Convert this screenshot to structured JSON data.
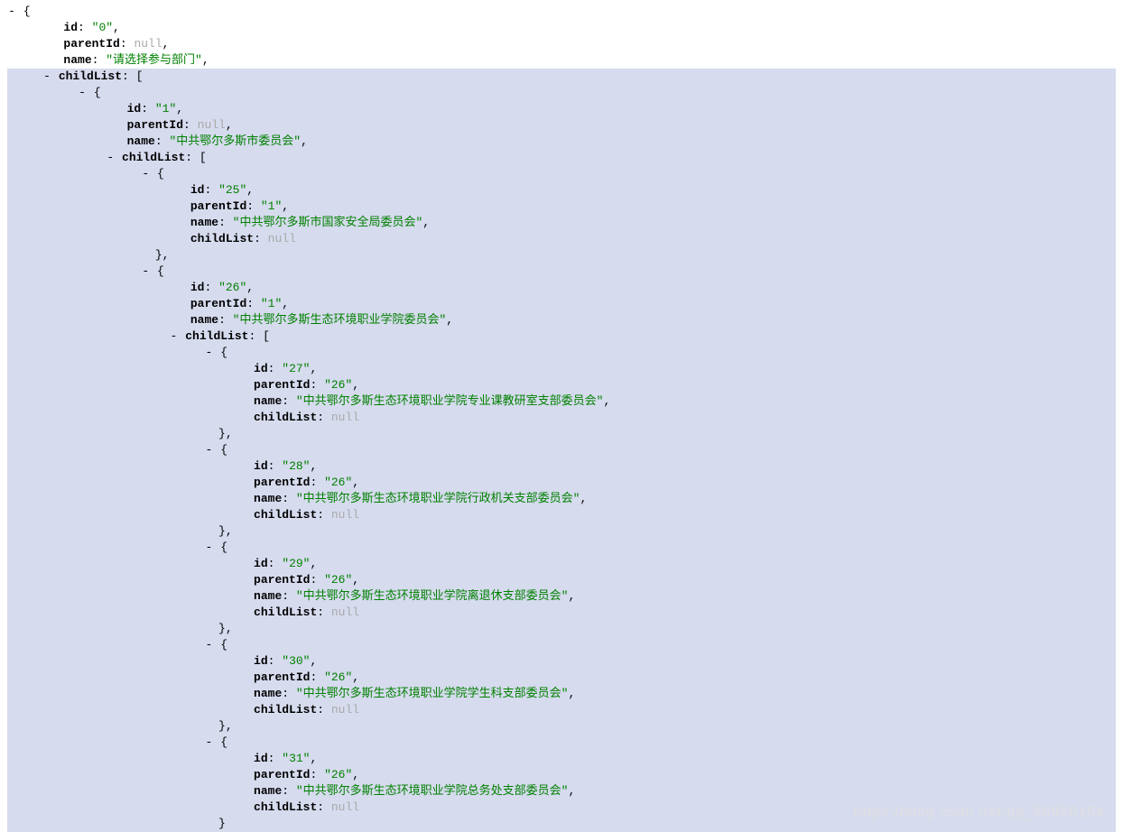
{
  "toggle": "-",
  "open": "{",
  "close": "}",
  "openArr": "[",
  "closeArr": "]",
  "comma": ",",
  "colon": ": ",
  "nullText": "null",
  "keys": {
    "id": "id",
    "parentId": "parentId",
    "name": "name",
    "childList": "childList"
  },
  "watermark": "https://blog.csdn.net/qq_36956154",
  "root": {
    "id": "\"0\"",
    "parentId": "null",
    "name": "\"请选择参与部门\"",
    "child": {
      "id": "\"1\"",
      "parentId": "null",
      "name": "\"中共鄂尔多斯市委员会\"",
      "n25": {
        "id": "\"25\"",
        "parentId": "\"1\"",
        "name": "\"中共鄂尔多斯市国家安全局委员会\"",
        "childList": "null"
      },
      "n26": {
        "id": "\"26\"",
        "parentId": "\"1\"",
        "name": "\"中共鄂尔多斯生态环境职业学院委员会\"",
        "c": [
          {
            "id": "\"27\"",
            "parentId": "\"26\"",
            "name": "\"中共鄂尔多斯生态环境职业学院专业课教研室支部委员会\"",
            "childList": "null"
          },
          {
            "id": "\"28\"",
            "parentId": "\"26\"",
            "name": "\"中共鄂尔多斯生态环境职业学院行政机关支部委员会\"",
            "childList": "null"
          },
          {
            "id": "\"29\"",
            "parentId": "\"26\"",
            "name": "\"中共鄂尔多斯生态环境职业学院离退休支部委员会\"",
            "childList": "null"
          },
          {
            "id": "\"30\"",
            "parentId": "\"26\"",
            "name": "\"中共鄂尔多斯生态环境职业学院学生科支部委员会\"",
            "childList": "null"
          },
          {
            "id": "\"31\"",
            "parentId": "\"26\"",
            "name": "\"中共鄂尔多斯生态环境职业学院总务处支部委员会\"",
            "childList": "null"
          }
        ]
      }
    }
  }
}
